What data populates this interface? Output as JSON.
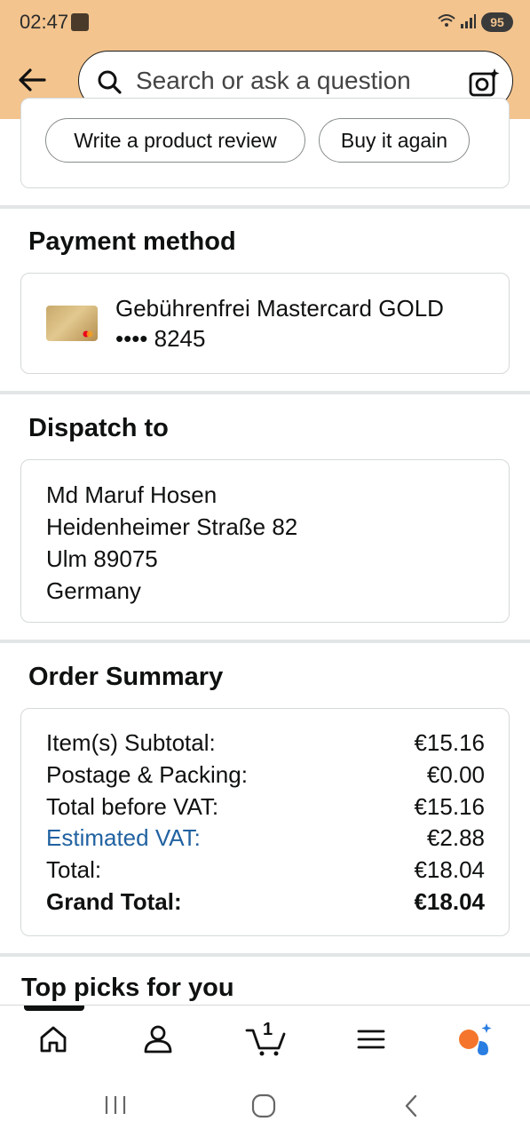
{
  "status_bar": {
    "time": "02:47",
    "battery": "95"
  },
  "header": {
    "search_placeholder": "Search or ask a question"
  },
  "actions": {
    "write_review": "Write a product review",
    "buy_again": "Buy it again"
  },
  "payment": {
    "title": "Payment method",
    "card_name": "Gebührenfrei Mastercard GOLD",
    "card_number": "•••• 8245"
  },
  "dispatch": {
    "title": "Dispatch to",
    "lines": [
      "Md Maruf Hosen",
      "Heidenheimer Straße 82",
      "Ulm 89075",
      "Germany"
    ]
  },
  "summary": {
    "title": "Order Summary",
    "rows": [
      {
        "label": "Item(s) Subtotal:",
        "value": "€15.16"
      },
      {
        "label": "Postage & Packing:",
        "value": "€0.00"
      },
      {
        "label": "Total before VAT:",
        "value": "€15.16"
      },
      {
        "label": "Estimated VAT:",
        "value": "€2.88"
      },
      {
        "label": "Total:",
        "value": "€18.04"
      },
      {
        "label": "Grand Total:",
        "value": "€18.04"
      }
    ]
  },
  "top_picks": {
    "title": "Top picks for you"
  },
  "bottom_nav": {
    "cart_count": "1"
  },
  "colors": {
    "header_bg": "#f3c48e",
    "link": "#2162a1",
    "assistant_orange": "#f4752b",
    "assistant_blue": "#2a7de1"
  }
}
